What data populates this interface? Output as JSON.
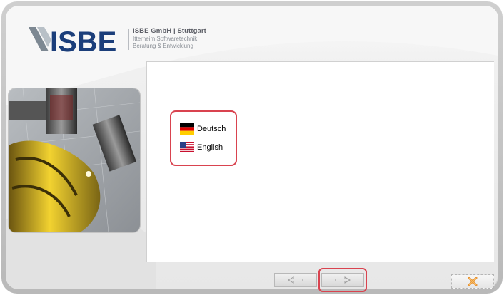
{
  "header": {
    "logo_text": "ISBE",
    "company_name": "ISBE GmbH | Stuttgart",
    "tagline_1": "Itterheim Softwaretechnik",
    "tagline_2": "Beratung & Entwicklung"
  },
  "languages": [
    {
      "label": "Deutsch",
      "icon": "german-flag-icon"
    },
    {
      "label": "English",
      "icon": "us-flag-icon"
    }
  ],
  "navigation": {
    "back_icon": "arrow-left-icon",
    "next_icon": "arrow-right-icon",
    "close_icon": "close-x-icon"
  },
  "colors": {
    "highlight": "#d9434f",
    "logo_blue": "#1b3e7a"
  }
}
